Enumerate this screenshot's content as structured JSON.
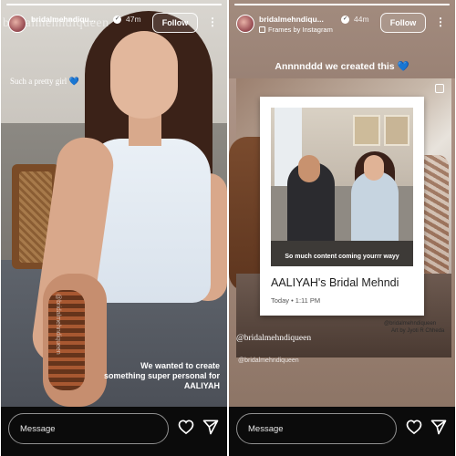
{
  "left_story": {
    "progress": 1.0,
    "username": "bridalmehndiqu...",
    "time": "47m",
    "follow_label": "Follow",
    "more_icon": "more-vertical-icon",
    "watermark_top": "bridalmehndiqueen",
    "caption_top_left": "Such a pretty girl",
    "caption_top_left_emoji": "💙",
    "vertical_watermark": "@bridalmehndiqueen",
    "caption_bottom_right": "We wanted to create something super personal for AALIYAH",
    "message_placeholder": "Message",
    "like_icon": "heart-outline-icon",
    "send_icon": "send-icon"
  },
  "right_story": {
    "progress": 1.0,
    "username": "bridalmehndiqu...",
    "time": "44m",
    "subtitle": "Frames by Instagram",
    "follow_label": "Follow",
    "more_icon": "more-vertical-icon",
    "caption_top": "Annnnddd we created this",
    "caption_top_emoji": "💙",
    "polaroid": {
      "photo_text": "So much content coming yourrr wayy",
      "title": "AALIYAH's Bridal Mehndi",
      "date": "Today • 1:11 PM"
    },
    "credit_line_1": "@bridalmehndiqueen",
    "credit_line_2": "Art by Jyoti R Chheda",
    "handle_mid": "@bridalmehndiqueen",
    "handle_small": "@bridalmehndiqueen",
    "message_placeholder": "Message",
    "like_icon": "heart-outline-icon",
    "send_icon": "send-icon"
  },
  "colors": {
    "bar_background": "#0b0b0b",
    "heart_emoji": "#7ec9ff",
    "text_white": "#ffffff"
  }
}
